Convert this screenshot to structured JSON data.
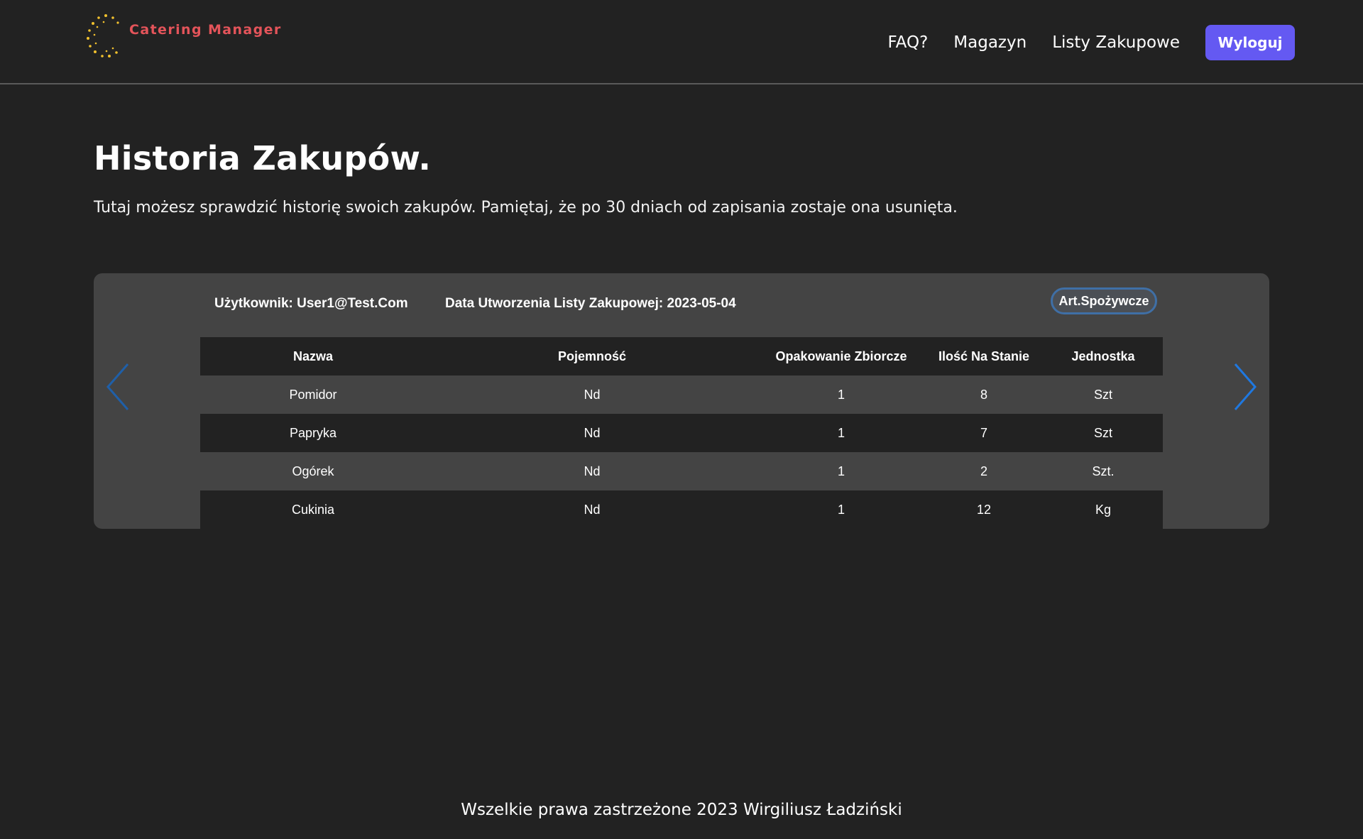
{
  "brand": {
    "name": "Catering Manager",
    "logo_icon": "dotted-circle-logo-icon"
  },
  "nav": {
    "items": [
      {
        "label": "FAQ?"
      },
      {
        "label": "Magazyn"
      },
      {
        "label": "Listy Zakupowe"
      }
    ],
    "logout_label": "Wyloguj"
  },
  "hero": {
    "title": "Historia Zakupów.",
    "subtitle": "Tutaj możesz sprawdzić historię swoich zakupów. Pamiętaj, że po 30 dniach od zapisania zostaje ona usunięta."
  },
  "history": {
    "user_label": "Użytkownik: User1@Test.Com",
    "date_label": "Data Utworzenia Listy Zakupowej: 2023-05-04",
    "category_badge": "Art.Spożywcze",
    "prev_icon": "chevron-left-icon",
    "next_icon": "chevron-right-icon",
    "columns": [
      "Nazwa",
      "Pojemność",
      "Opakowanie Zbiorcze",
      "Ilość Na Stanie",
      "Jednostka"
    ],
    "rows": [
      [
        "Pomidor",
        "Nd",
        "1",
        "8",
        "Szt"
      ],
      [
        "Papryka",
        "Nd",
        "1",
        "7",
        "Szt"
      ],
      [
        "Ogórek",
        "Nd",
        "1",
        "2",
        "Szt."
      ],
      [
        "Cukinia",
        "Nd",
        "1",
        "12",
        "Kg"
      ]
    ]
  },
  "footer": {
    "text": "Wszelkie prawa zastrzeżone 2023 Wirgiliusz Ładziński"
  },
  "colors": {
    "background": "#222222",
    "card": "#444444",
    "accent": "#6459f2",
    "brand_text": "#e4545a",
    "logo_dots": "#f2c12e",
    "arrow": "#1f78e0"
  }
}
